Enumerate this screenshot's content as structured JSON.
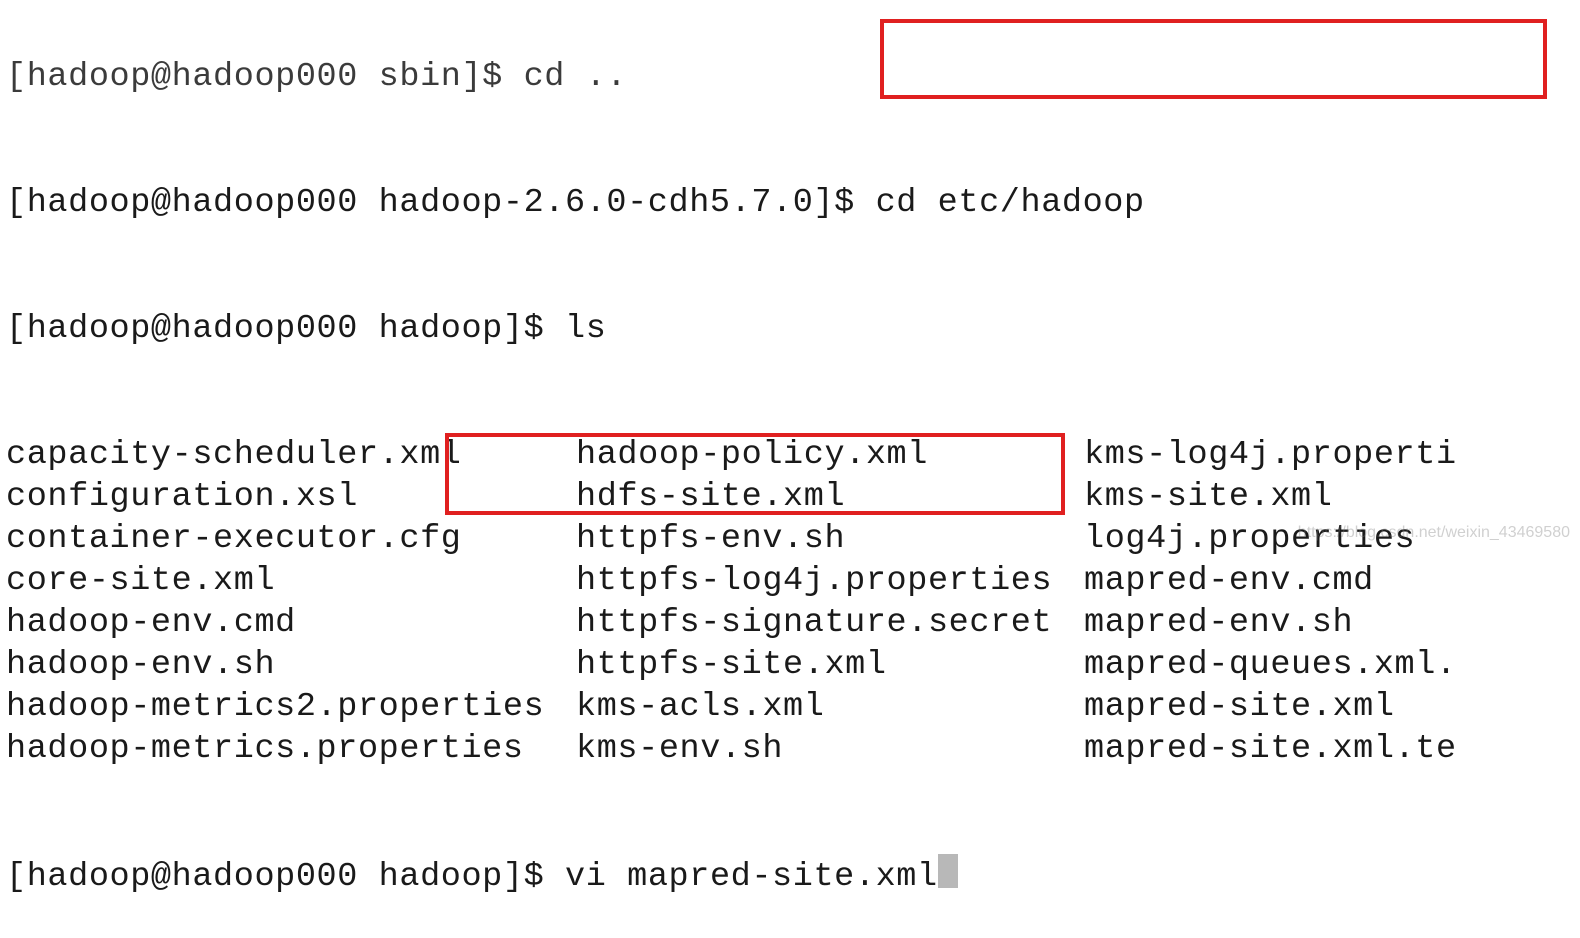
{
  "topFragment": "[hadoop@hadoop000 sbin]$ cd ..",
  "lines": {
    "cd": {
      "prompt": "[hadoop@hadoop000 hadoop-2.6.0-cdh5.7.0]$",
      "cmd": "cd etc/hadoop"
    },
    "ls": {
      "prompt": "[hadoop@hadoop000 hadoop]$",
      "cmd": "ls"
    },
    "vi": {
      "prompt": "[hadoop@hadoop000 hadoop]$",
      "cmd": "vi mapred-site.xml"
    }
  },
  "lsColumns": {
    "col1": [
      "capacity-scheduler.xml",
      "configuration.xsl",
      "container-executor.cfg",
      "core-site.xml",
      "hadoop-env.cmd",
      "hadoop-env.sh",
      "hadoop-metrics2.properties",
      "hadoop-metrics.properties"
    ],
    "col2": [
      "hadoop-policy.xml",
      "hdfs-site.xml",
      "httpfs-env.sh",
      "httpfs-log4j.properties",
      "httpfs-signature.secret",
      "httpfs-site.xml",
      "kms-acls.xml",
      "kms-env.sh"
    ],
    "col3": [
      "kms-log4j.properti",
      "kms-site.xml",
      "log4j.properties",
      "mapred-env.cmd",
      "mapred-env.sh",
      "mapred-queues.xml.",
      "mapred-site.xml",
      "mapred-site.xml.te"
    ]
  },
  "watermark": "https://blog.csdn.net/weixin_43469580"
}
